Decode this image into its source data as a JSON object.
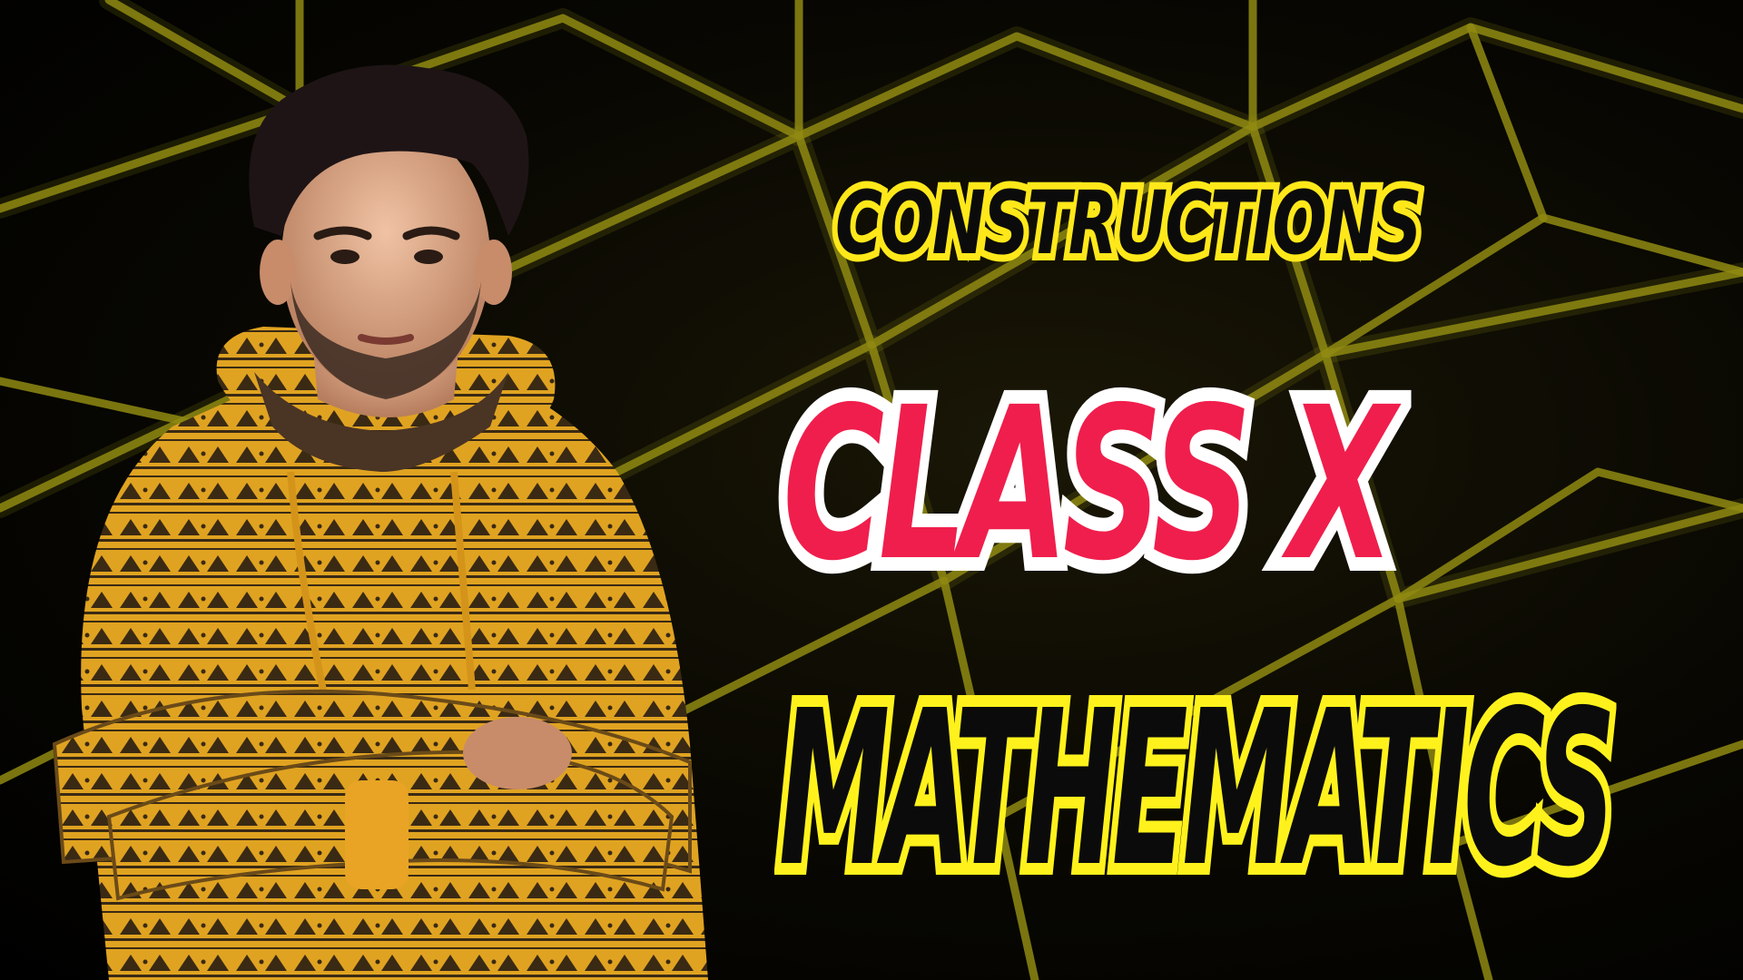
{
  "thumbnail": {
    "line1": "CONSTRUCTIONS",
    "line2": "CLASS X",
    "line3": "MATHEMATICS"
  },
  "colors": {
    "background": "#000000",
    "grid_lines": "#8f8a12",
    "line1_fill": "#0b0b0b",
    "line1_outline": "#ffe81a",
    "line2_fill": "#f01e4c",
    "line2_outline": "#ffffff",
    "line3_fill": "#0b0b0b",
    "line3_outline": "#fff21c",
    "hoodie": "#e0a321",
    "hoodie_pattern": "#3a2a14"
  }
}
